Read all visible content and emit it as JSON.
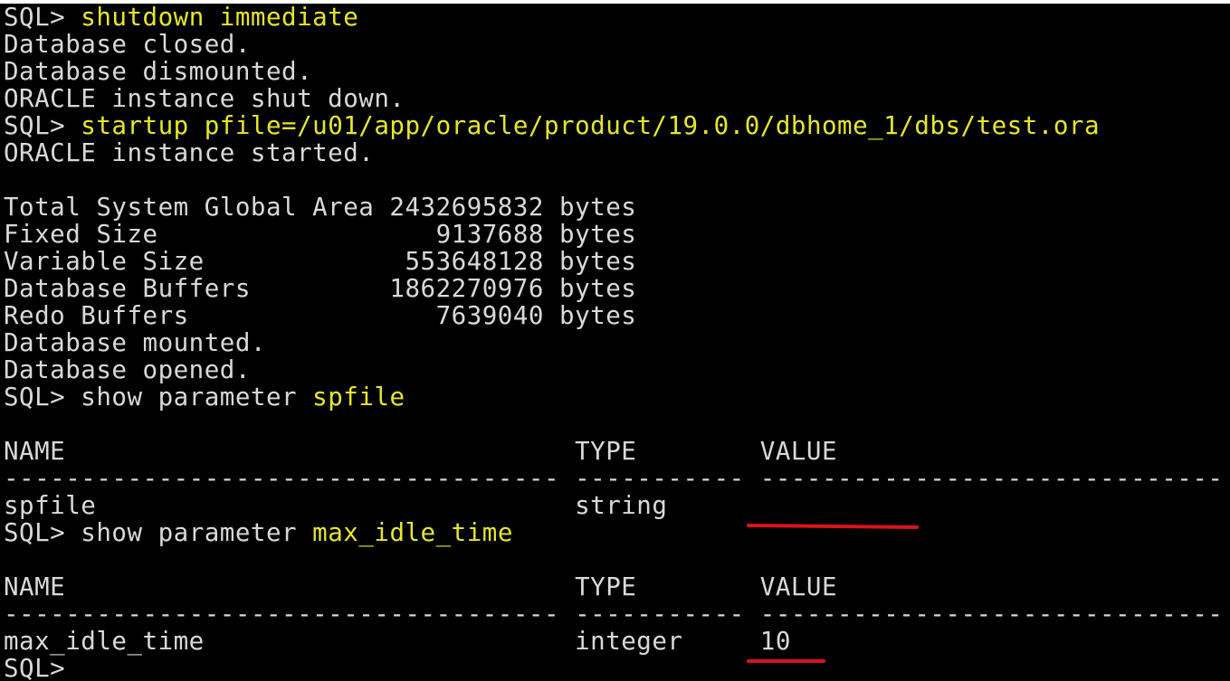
{
  "terminal": {
    "lines": [
      {
        "prompt": "SQL> ",
        "cmd": "shutdown immediate",
        "rest": ""
      },
      {
        "text": "Database closed."
      },
      {
        "text": "Database dismounted."
      },
      {
        "text": "ORACLE instance shut down."
      },
      {
        "prompt": "SQL> ",
        "cmd": "startup pfile=/u01/app/oracle/product/19.0.0/dbhome_1/dbs/test.ora",
        "rest": ""
      },
      {
        "text": "ORACLE instance started."
      },
      {
        "text": ""
      },
      {
        "text": "Total System Global Area 2432695832 bytes"
      },
      {
        "text": "Fixed Size                  9137688 bytes"
      },
      {
        "text": "Variable Size             553648128 bytes"
      },
      {
        "text": "Database Buffers         1862270976 bytes"
      },
      {
        "text": "Redo Buffers                7639040 bytes"
      },
      {
        "text": "Database mounted."
      },
      {
        "text": "Database opened."
      },
      {
        "prompt": "SQL> ",
        "plain": "show parameter ",
        "cmd": "spfile"
      },
      {
        "text": ""
      },
      {
        "text": "NAME                                 TYPE        VALUE"
      },
      {
        "text": "------------------------------------ ----------- ------------------------------"
      },
      {
        "text": "spfile                               string"
      },
      {
        "prompt": "SQL> ",
        "plain": "show parameter ",
        "cmd": "max_idle_time"
      },
      {
        "text": ""
      },
      {
        "text": "NAME                                 TYPE        VALUE"
      },
      {
        "text": "------------------------------------ ----------- ------------------------------"
      },
      {
        "text": "max_idle_time                        integer     10"
      },
      {
        "text": "SQL> "
      }
    ]
  },
  "colors": {
    "background": "#000000",
    "text": "#d9d9d9",
    "command_highlight": "#e6e62a",
    "annotation_underline": "#d8141c"
  }
}
